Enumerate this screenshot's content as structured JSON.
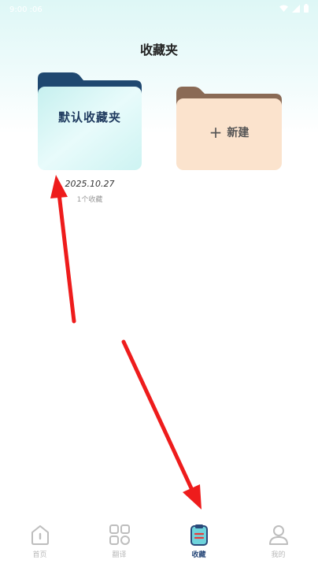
{
  "status_bar": {
    "time": "9:00 :06",
    "icons": [
      "wifi-icon",
      "signal-icon",
      "battery-icon"
    ]
  },
  "page": {
    "title": "收藏夹"
  },
  "folders": [
    {
      "name": "默认收藏夹",
      "date": "2025.10.27",
      "count": "1个收藏",
      "color": "#1f4870"
    },
    {
      "name": "新建",
      "plus": "+",
      "color": "#8a6a55"
    }
  ],
  "tabs": [
    {
      "label": "首页",
      "icon": "home-icon",
      "active": false
    },
    {
      "label": "翻译",
      "icon": "grid-icon",
      "active": false
    },
    {
      "label": "收藏",
      "icon": "clipboard-icon",
      "active": true
    },
    {
      "label": "我的",
      "icon": "user-icon",
      "active": false
    }
  ],
  "colors": {
    "accent": "#2a4a7a",
    "arrow": "#ee1c1c",
    "active_icon_bg": "#6fd4dc"
  }
}
